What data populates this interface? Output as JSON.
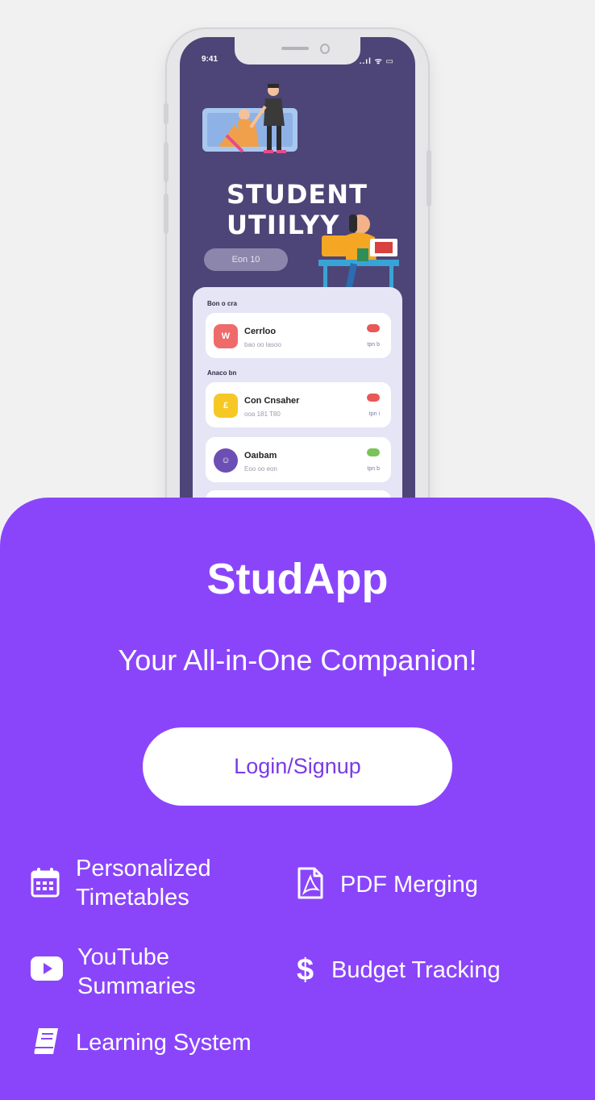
{
  "mockup": {
    "status_time": "9:41",
    "status_indicators": "..ıl ᯤ ▭",
    "hero_title_line1": "STUDENT",
    "hero_title_line2": "UTIILYY",
    "hero_button": "Eon 10",
    "section1_label": "Bon o cra",
    "section2_label": "Anaco bn",
    "rows": [
      {
        "name": "Cerrloo",
        "sub": "bao oo lasoo",
        "meta": "tpn b",
        "icon_color": "#ef6a6a",
        "toggle_color": "#e95757"
      },
      {
        "name": "Con Cnsaher",
        "sub": "ooa 181 T80",
        "meta": "tpn i",
        "icon_color": "#f5c826",
        "toggle_color": "#e95757"
      },
      {
        "name": "Oaıbam",
        "sub": "Eoo oo eon",
        "meta": "tpn b",
        "icon_color": "#6c4fb5",
        "toggle_color": "#79c35a"
      }
    ]
  },
  "app": {
    "title": "StudApp",
    "tagline": "Your All-in-One Companion!",
    "login_label": "Login/Signup"
  },
  "features": {
    "timetables": {
      "line1": "Personalized",
      "line2": "Timetables",
      "icon": "calendar-icon"
    },
    "pdf": {
      "label": "PDF Merging",
      "icon": "pdf-file-icon"
    },
    "youtube": {
      "line1": "YouTube",
      "line2": "Summaries",
      "icon": "youtube-icon"
    },
    "budget": {
      "label": "Budget Tracking",
      "icon": "dollar-icon"
    },
    "learning": {
      "label": "Learning System",
      "icon": "book-icon"
    }
  },
  "colors": {
    "sheet": "#8a45fb",
    "screen": "#4d4577",
    "login_text": "#7b3be4",
    "background": "#f1f1f1"
  }
}
